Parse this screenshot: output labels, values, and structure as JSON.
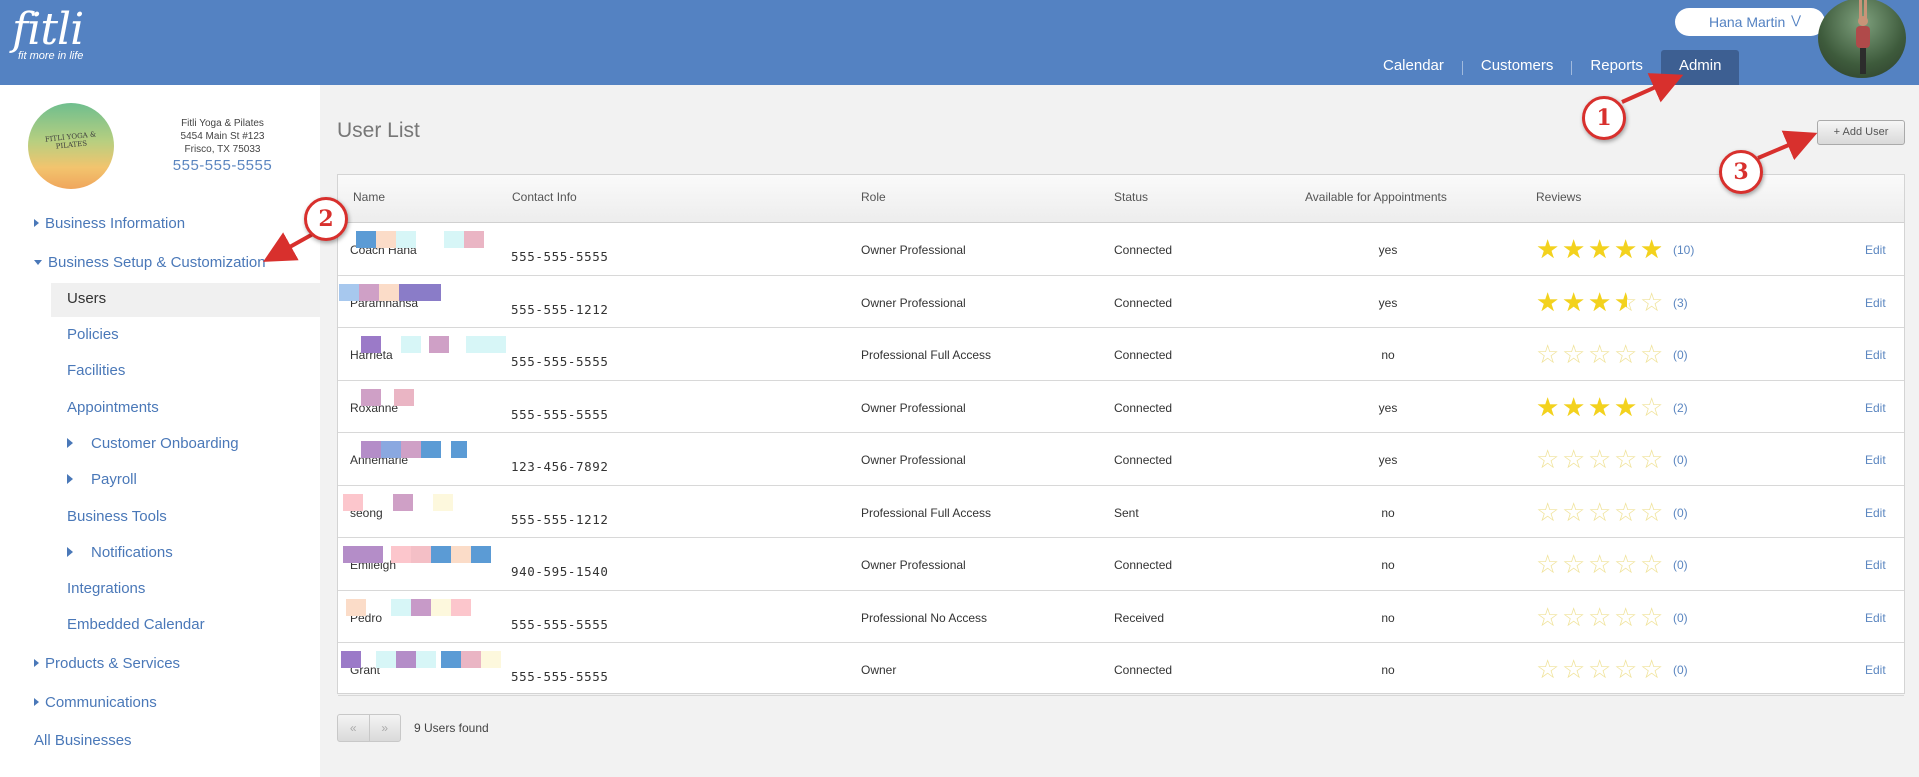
{
  "app": {
    "logo_word": "fitli",
    "logo_tagline": "fit more in life",
    "user_name": "Hana Martin",
    "nav": [
      {
        "label": "Calendar",
        "active": false
      },
      {
        "label": "Customers",
        "active": false
      },
      {
        "label": "Reports",
        "active": false
      },
      {
        "label": "Admin",
        "active": true
      }
    ]
  },
  "business": {
    "logo_text": "FITLI YOGA & PILATES",
    "name": "Fitli Yoga & Pilates",
    "address1": "5454 Main St #123",
    "address2": "Frisco, TX 75033",
    "phone": "555-555-5555"
  },
  "sidebar": {
    "business_information": "Business Information",
    "business_setup": "Business Setup & Customization",
    "sub_items": [
      {
        "label": "Users",
        "selected": true,
        "has_arrow": false
      },
      {
        "label": "Policies",
        "selected": false,
        "has_arrow": false
      },
      {
        "label": "Facilities",
        "selected": false,
        "has_arrow": false
      },
      {
        "label": "Appointments",
        "selected": false,
        "has_arrow": false
      },
      {
        "label": "Customer Onboarding",
        "selected": false,
        "has_arrow": true
      },
      {
        "label": "Payroll",
        "selected": false,
        "has_arrow": true
      },
      {
        "label": "Business Tools",
        "selected": false,
        "has_arrow": false
      },
      {
        "label": "Notifications",
        "selected": false,
        "has_arrow": true
      },
      {
        "label": "Integrations",
        "selected": false,
        "has_arrow": false
      },
      {
        "label": "Embedded Calendar",
        "selected": false,
        "has_arrow": false
      }
    ],
    "products_services": "Products & Services",
    "communications": "Communications",
    "all_businesses": "All Businesses"
  },
  "main": {
    "title": "User List",
    "add_user_label": "+ Add User",
    "columns": [
      "Name",
      "Contact Info",
      "Role",
      "Status",
      "Available for Appointments",
      "Reviews",
      ""
    ],
    "rows": [
      {
        "name": "Coach Hana",
        "phone": "555-555-5555",
        "role": "Owner Professional",
        "status": "Connected",
        "available": "yes",
        "rating": 4.8,
        "reviews": "(10)",
        "edit": "Edit"
      },
      {
        "name": "Paramhansa",
        "phone": "555-555-1212",
        "role": "Owner Professional",
        "status": "Connected",
        "available": "yes",
        "rating": 3.5,
        "reviews": "(3)",
        "edit": "Edit"
      },
      {
        "name": "Harrieta",
        "phone": "555-555-5555",
        "role": "Professional Full Access",
        "status": "Connected",
        "available": "no",
        "rating": 0,
        "reviews": "(0)",
        "edit": "Edit"
      },
      {
        "name": "Roxanne",
        "phone": "555-555-5555",
        "role": "Owner Professional",
        "status": "Connected",
        "available": "yes",
        "rating": 4,
        "reviews": "(2)",
        "edit": "Edit"
      },
      {
        "name": "Annemarie",
        "phone": "123-456-7892",
        "role": "Owner Professional",
        "status": "Connected",
        "available": "yes",
        "rating": 0,
        "reviews": "(0)",
        "edit": "Edit"
      },
      {
        "name": "seong",
        "phone": "555-555-1212",
        "role": "Professional Full Access",
        "status": "Sent",
        "available": "no",
        "rating": 0,
        "reviews": "(0)",
        "edit": "Edit"
      },
      {
        "name": "Emileigh",
        "phone": "940-595-1540",
        "role": "Owner Professional",
        "status": "Connected",
        "available": "no",
        "rating": 0,
        "reviews": "(0)",
        "edit": "Edit"
      },
      {
        "name": "Pedro",
        "phone": "555-555-5555",
        "role": "Professional No Access",
        "status": "Received",
        "available": "no",
        "rating": 0,
        "reviews": "(0)",
        "edit": "Edit"
      },
      {
        "name": "Grant",
        "phone": "555-555-5555",
        "role": "Owner",
        "status": "Connected",
        "available": "no",
        "rating": 0,
        "reviews": "(0)",
        "edit": "Edit"
      }
    ],
    "pager_prev": "«",
    "pager_next": "»",
    "found_text": "9 Users found"
  },
  "annotations": {
    "badges": [
      "1",
      "2",
      "3"
    ],
    "color": "#d8302d"
  },
  "colors": {
    "header": "#5482c2",
    "admin_tab": "#3d5f92",
    "link": "#4a78b8",
    "star": "#f3d21d"
  }
}
